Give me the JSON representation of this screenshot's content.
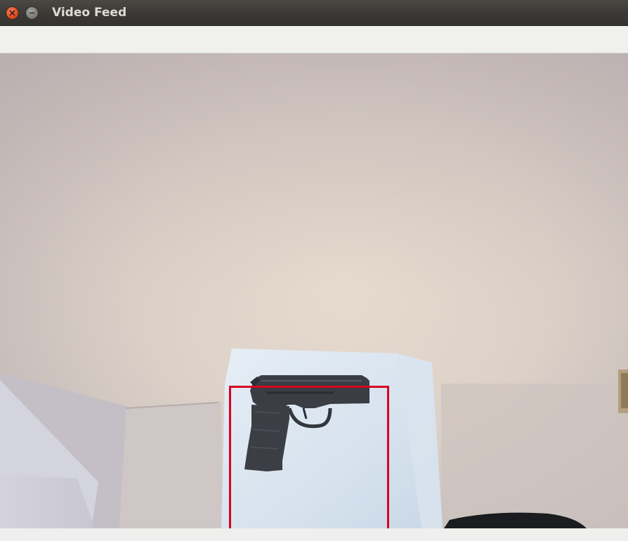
{
  "window": {
    "title": "Video Feed",
    "buttons": {
      "close_icon": "close-icon",
      "minimize_icon": "minimize-icon"
    }
  },
  "video": {
    "detection": {
      "box_color": "#d8001f"
    }
  },
  "colors": {
    "titlebar": "#3a3935",
    "close_button": "#df4a1e",
    "minimize_button": "#7c7b74",
    "detection_box": "#d8001f"
  }
}
